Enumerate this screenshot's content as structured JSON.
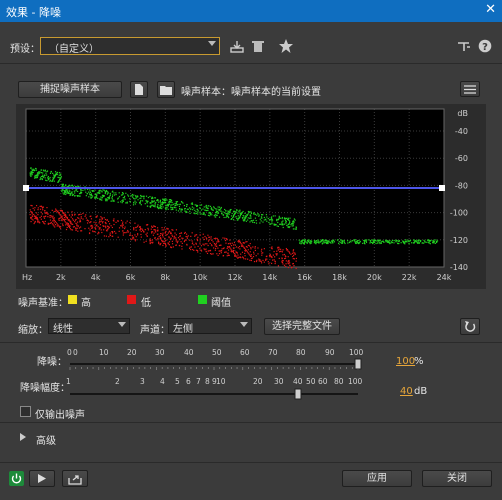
{
  "window": {
    "title": "效果 - 降噪",
    "close": "✕"
  },
  "preset": {
    "label": "预设：",
    "value": "（自定义）"
  },
  "toolbar": {
    "capture_label": "捕捉噪声样本",
    "sample_info": "噪声样本：噪声样本的当前设置"
  },
  "graph": {
    "ylabels": [
      "dB",
      "-40",
      "-60",
      "-80",
      "-100",
      "-120",
      "-140"
    ],
    "xlabels": [
      "Hz",
      "2k",
      "4k",
      "6k",
      "8k",
      "10k",
      "12k",
      "14k",
      "16k",
      "18k",
      "20k",
      "22k",
      "24k"
    ]
  },
  "legend": {
    "label": "噪声基准：",
    "items": [
      {
        "label": "高",
        "color": "#f0e020"
      },
      {
        "label": "低",
        "color": "#e01818"
      },
      {
        "label": "阈值",
        "color": "#20d020"
      }
    ]
  },
  "controls": {
    "scale_label": "缩放：",
    "scale_value": "线性",
    "channel_label": "声道：",
    "channel_value": "左侧",
    "select_file": "选择完整文件"
  },
  "reduction": {
    "label": "降噪：",
    "ticks": [
      "0",
      "0",
      "10",
      "20",
      "30",
      "40",
      "50",
      "60",
      "70",
      "80",
      "90",
      "100"
    ],
    "value": "100",
    "unit": "%",
    "level": 1.0
  },
  "amount": {
    "label": "降噪幅度：",
    "ticks": [
      "1",
      "2",
      "3",
      "4",
      "5",
      "6",
      "7",
      "8",
      "9",
      "10",
      "20",
      "30",
      "40",
      "50",
      "60",
      "80",
      "100"
    ],
    "value": "40",
    "unit": "dB"
  },
  "output_only": {
    "label": "仅输出噪声"
  },
  "advanced": {
    "label": "高级"
  },
  "footer": {
    "apply": "应用",
    "close": "关闭"
  }
}
